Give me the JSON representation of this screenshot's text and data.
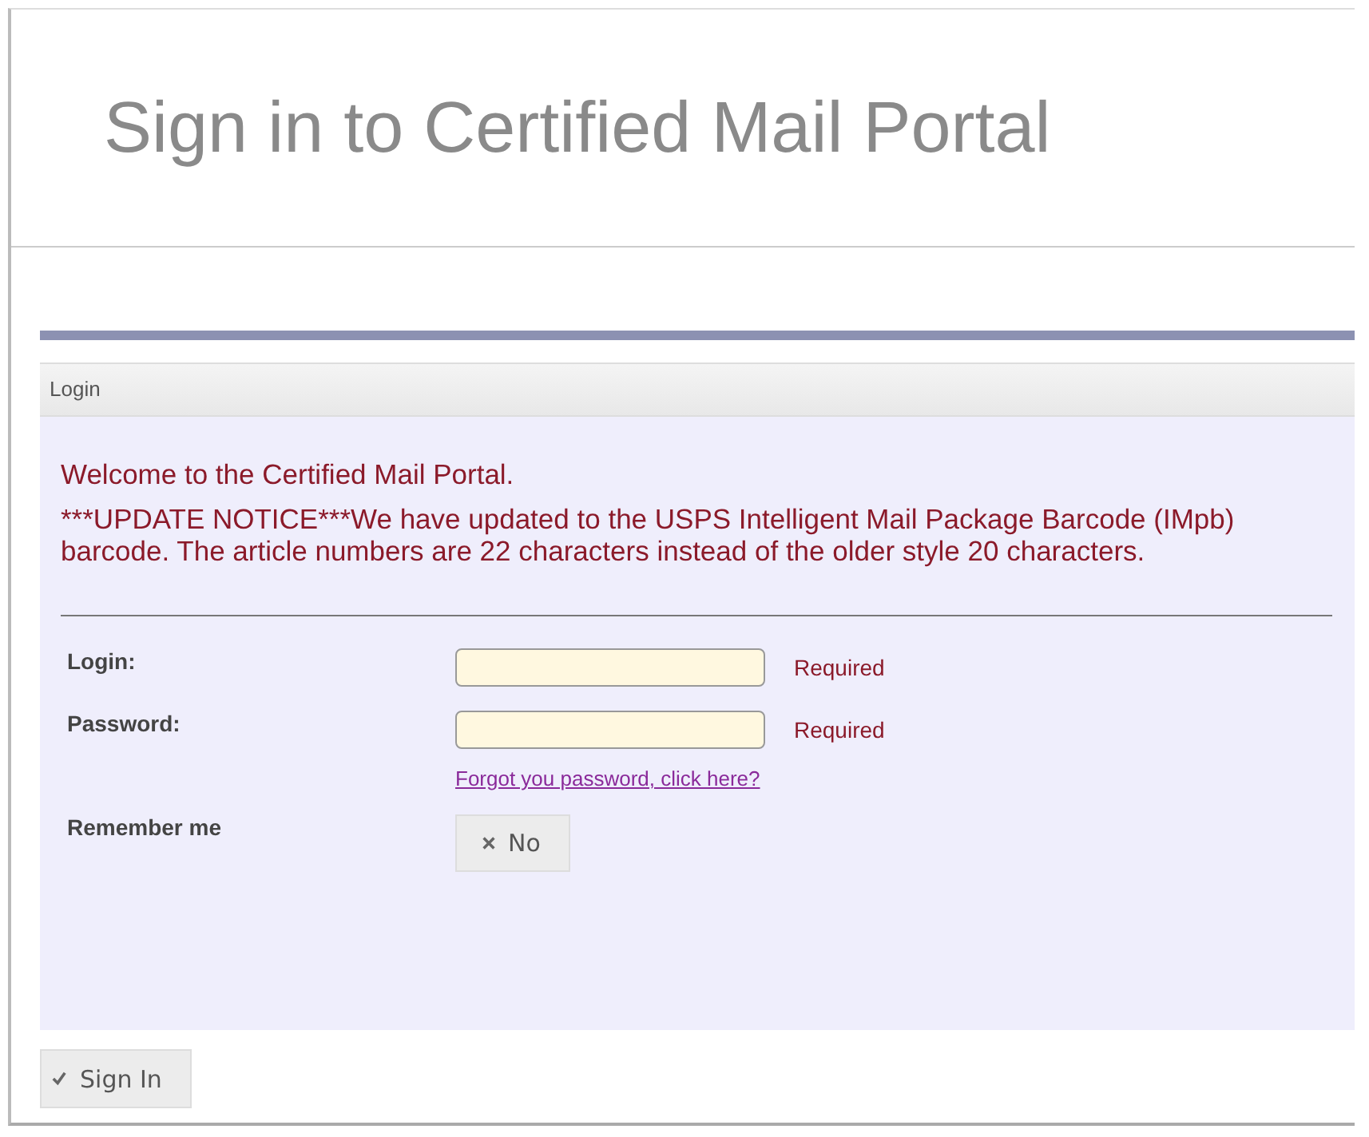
{
  "title": "Sign in to Certified Mail Portal",
  "panel": {
    "header": "Login",
    "messages": [
      "Welcome to the Certified Mail Portal.",
      "***UPDATE NOTICE***We have updated to the USPS Intelligent Mail Package Barcode (IMpb) barcode. The article numbers are 22 characters instead of the older style 20 characters."
    ],
    "fields": [
      {
        "label": "Login:",
        "hint": "Required"
      },
      {
        "label": "Password:",
        "hint": "Required"
      }
    ],
    "forgot_link": "Forgot you password, click here?",
    "remember": {
      "label": "Remember me",
      "text": "No",
      "checked": false
    }
  },
  "submit": "Sign In"
}
